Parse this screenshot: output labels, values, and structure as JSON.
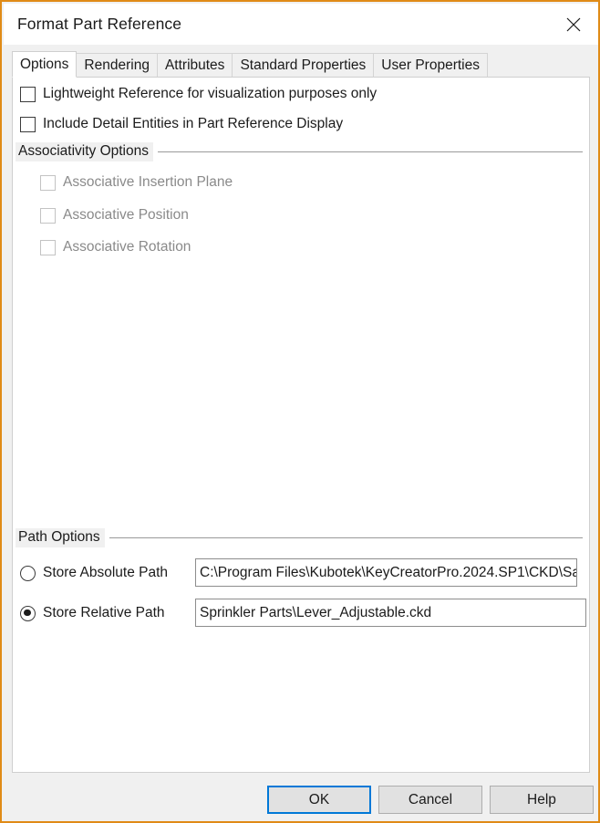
{
  "window": {
    "title": "Format Part Reference",
    "close_icon": "close-x-icon",
    "border_color": "#e08b17"
  },
  "tabs": [
    {
      "label": "Options",
      "selected": true
    },
    {
      "label": "Rendering",
      "selected": false
    },
    {
      "label": "Attributes",
      "selected": false
    },
    {
      "label": "Standard Properties",
      "selected": false
    },
    {
      "label": "User Properties",
      "selected": false
    }
  ],
  "options_tab": {
    "checkboxes": [
      {
        "label": "Lightweight Reference for visualization purposes only",
        "checked": false,
        "enabled": true
      },
      {
        "label": "Include Detail Entities in Part Reference Display",
        "checked": false,
        "enabled": true
      }
    ],
    "associativity_group": {
      "label": "Associativity Options",
      "checkboxes": [
        {
          "label": "Associative Insertion Plane",
          "checked": false,
          "enabled": false
        },
        {
          "label": "Associative Position",
          "checked": false,
          "enabled": false
        },
        {
          "label": "Associative Rotation",
          "checked": false,
          "enabled": false
        }
      ]
    },
    "path_group": {
      "label": "Path Options",
      "radios": [
        {
          "label": "Store Absolute Path",
          "selected": false
        },
        {
          "label": "Store Relative Path",
          "selected": true
        }
      ],
      "absolute_path_value": "C:\\Program Files\\Kubotek\\KeyCreatorPro.2024.SP1\\CKD\\Sa",
      "relative_path_value": "Sprinkler Parts\\Lever_Adjustable.ckd"
    }
  },
  "footer": {
    "ok_label": "OK",
    "cancel_label": "Cancel",
    "help_label": "Help",
    "default_button_accent": "#0078d7"
  }
}
